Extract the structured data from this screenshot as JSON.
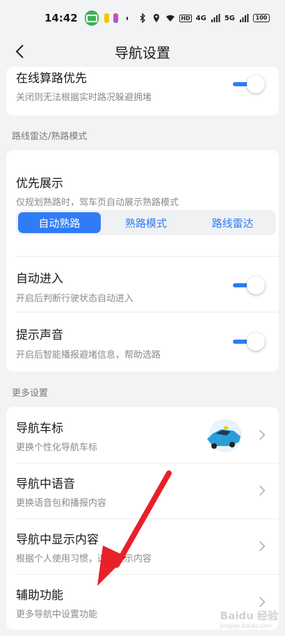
{
  "status_bar": {
    "time": "14:42",
    "network_label": "HD",
    "signal_1": "4G",
    "signal_2": "5G",
    "battery": "100"
  },
  "nav": {
    "title": "导航设置",
    "back_icon": "chevron-left-icon"
  },
  "top_card": {
    "title": "在线算路优先",
    "subtitle": "关闭则无法根据实时路况躲避拥堵",
    "toggle_on": true
  },
  "radar_section": {
    "label": "路线雷达/熟路模式",
    "priority": {
      "title": "优先展示",
      "subtitle": "仅规划熟路时，驾车页自动展示熟路模式",
      "options": [
        "自动熟路",
        "熟路模式",
        "路线雷达"
      ],
      "selected": "自动熟路"
    },
    "auto_enter": {
      "title": "自动进入",
      "subtitle": "开启后判断行驶状态自动进入",
      "toggle_on": true
    },
    "sound": {
      "title": "提示声音",
      "subtitle": "开启后智能播报避堵信息，帮助选路",
      "toggle_on": true
    }
  },
  "more_section": {
    "label": "更多设置",
    "items": [
      {
        "title": "导航车标",
        "subtitle": "更换个性化导航车标"
      },
      {
        "title": "导航中语音",
        "subtitle": "更换语音包和播报内容"
      },
      {
        "title": "导航中显示内容",
        "subtitle": "根据个人使用习惯，选择显示内容"
      },
      {
        "title": "辅助功能",
        "subtitle": "更多导航中设置功能"
      }
    ]
  },
  "watermark": {
    "brand": "Baidu 经验",
    "url": "jingyan.baidu.com"
  },
  "colors": {
    "accent": "#2f7cf6",
    "arrow": "#e8202a",
    "background": "#f2f3f5"
  }
}
